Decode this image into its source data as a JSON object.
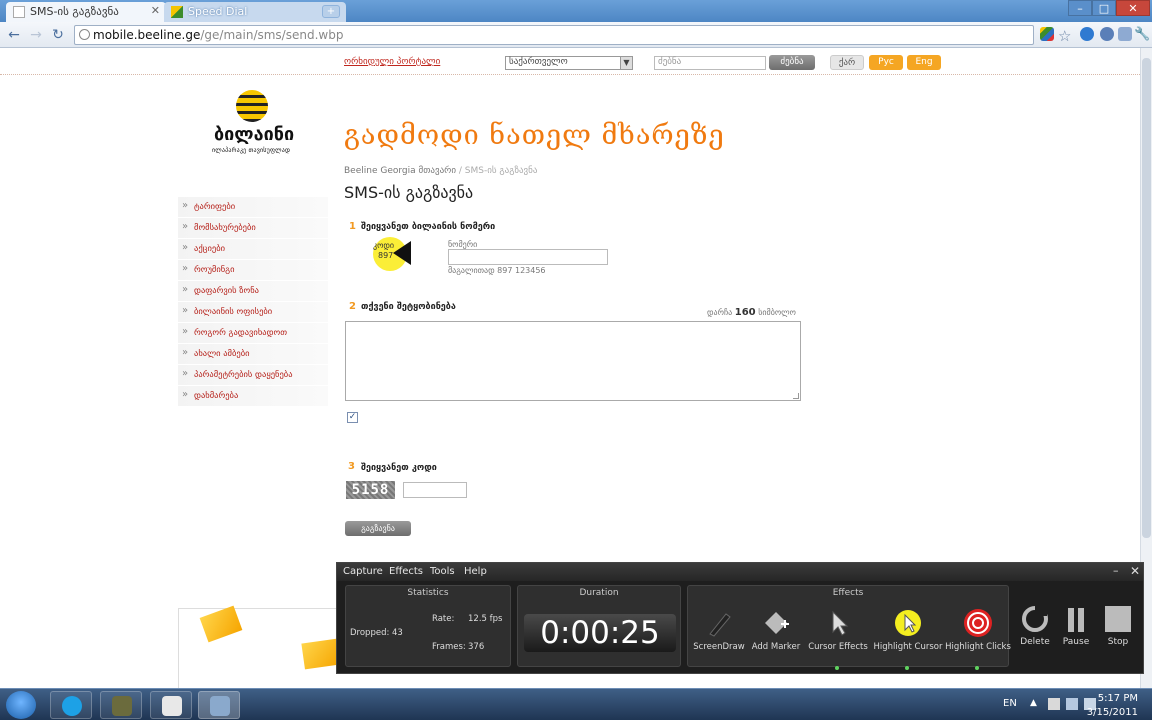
{
  "browser": {
    "tabs": [
      {
        "label": "SMS-ის გაგზავნა",
        "active": true
      },
      {
        "label": "Speed Dial",
        "active": false
      }
    ],
    "url_host": "mobile.beeline.ge",
    "url_path": "/ge/main/sms/send.wbp"
  },
  "topnav": {
    "link": "ორხიდული პორტალი",
    "region_select": "საქართველო",
    "search_placeholder": "ძებნა",
    "search_button": "ძებნა",
    "lang_ka": "ქარ",
    "lang_ru": "Рус",
    "lang_en": "Eng"
  },
  "brand": {
    "logo": "ბილაინი",
    "slogan": "ილაპარაკე თავისუფლად"
  },
  "hero": {
    "title": "გადმოდი ნათელ მხარეზე"
  },
  "breadcrumb": {
    "home": "Beeline Georgia მთავარი",
    "sep": " / ",
    "current": "SMS-ის გაგზავნა"
  },
  "page_title": "SMS-ის გაგზავნა",
  "sidebar": {
    "items": [
      {
        "label": "ტარიფები"
      },
      {
        "label": "მომსახურებები"
      },
      {
        "label": "აქციები"
      },
      {
        "label": "როუმინგი"
      },
      {
        "label": "დაფარვის ზონა"
      },
      {
        "label": "ბილაინის ოფისები"
      },
      {
        "label": "როგორ გადავიხადოთ"
      },
      {
        "label": "ახალი ამბები"
      },
      {
        "label": "პარამეტრების დაყენება"
      },
      {
        "label": "დახმარება"
      }
    ]
  },
  "form": {
    "step1": {
      "num": "1",
      "label": "შეიყვანეთ ბილაინის ნომერი",
      "prefix_label": "კოდი",
      "prefix_value": "897",
      "number_label": "ნომერი",
      "example": "მაგალითად 897 123456"
    },
    "step2": {
      "num": "2",
      "label": "თქვენი შეტყობინება",
      "counter_prefix": "დარჩა",
      "counter_value": "160",
      "counter_suffix": "სიმბოლო"
    },
    "checkbox_mark": "✓",
    "step3": {
      "num": "3",
      "label": "შეიყვანეთ კოდი",
      "captcha": "5158"
    },
    "send_button": "გაგზავნა"
  },
  "recorder": {
    "menu": [
      "Capture",
      "Effects",
      "Tools",
      "Help"
    ],
    "statistics": {
      "title": "Statistics",
      "dropped_label": "Dropped:",
      "dropped": "43",
      "rate_label": "Rate:",
      "rate": "12.5 fps",
      "frames_label": "Frames:",
      "frames": "376"
    },
    "duration": {
      "title": "Duration",
      "value": "0:00:25"
    },
    "effects": {
      "title": "Effects",
      "tools": [
        "ScreenDraw",
        "Add Marker",
        "Cursor Effects",
        "Highlight Cursor",
        "Highlight Clicks"
      ]
    },
    "controls": [
      "Delete",
      "Pause",
      "Stop"
    ]
  },
  "taskbar": {
    "lang": "EN",
    "time": "5:17 PM",
    "date": "3/15/2011"
  },
  "colors": {
    "accent_orange": "#f07a10",
    "link_red": "#c0271e",
    "brand_yellow": "#f7c600"
  }
}
